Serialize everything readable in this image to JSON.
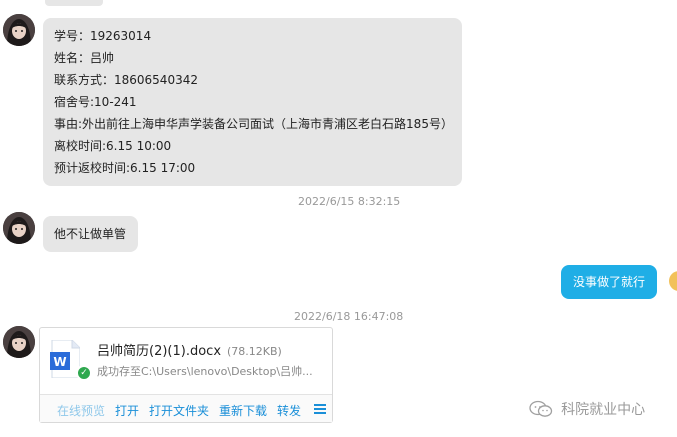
{
  "messages": {
    "msg1": {
      "lines": [
        "学号：19263014",
        "姓名：吕帅",
        "联系方式：18606540342",
        "宿舍号:10-241",
        "事由:外出前往上海申华声学装备公司面试（上海市青浦区老白石路185号）",
        "离校时间:6.15  10:00",
        "预计返校时间:6.15  17:00"
      ]
    },
    "timestamp1": "2022/6/15 8:32:15",
    "msg2": {
      "text": "他不让做单管"
    },
    "msg3": {
      "text": "没事做了就行"
    },
    "timestamp2": "2022/6/18 16:47:08",
    "file": {
      "name": "吕帅简历(2)(1).docx",
      "size": "(78.12KB)",
      "status": "成功存至C:\\Users\\lenovo\\Desktop\\吕帅...",
      "actions": [
        "在线预览",
        "打开",
        "打开文件夹",
        "重新下载",
        "转发"
      ]
    }
  },
  "watermark": {
    "text": "科院就业中心"
  },
  "colors": {
    "incoming_bubble": "#e6e6e6",
    "outgoing_bubble": "#1faee6",
    "link": "#1a8fd8"
  },
  "icons": [
    "avatar",
    "word-doc-icon",
    "check-badge-icon",
    "more-menu-icon",
    "wechat-logo-icon"
  ]
}
